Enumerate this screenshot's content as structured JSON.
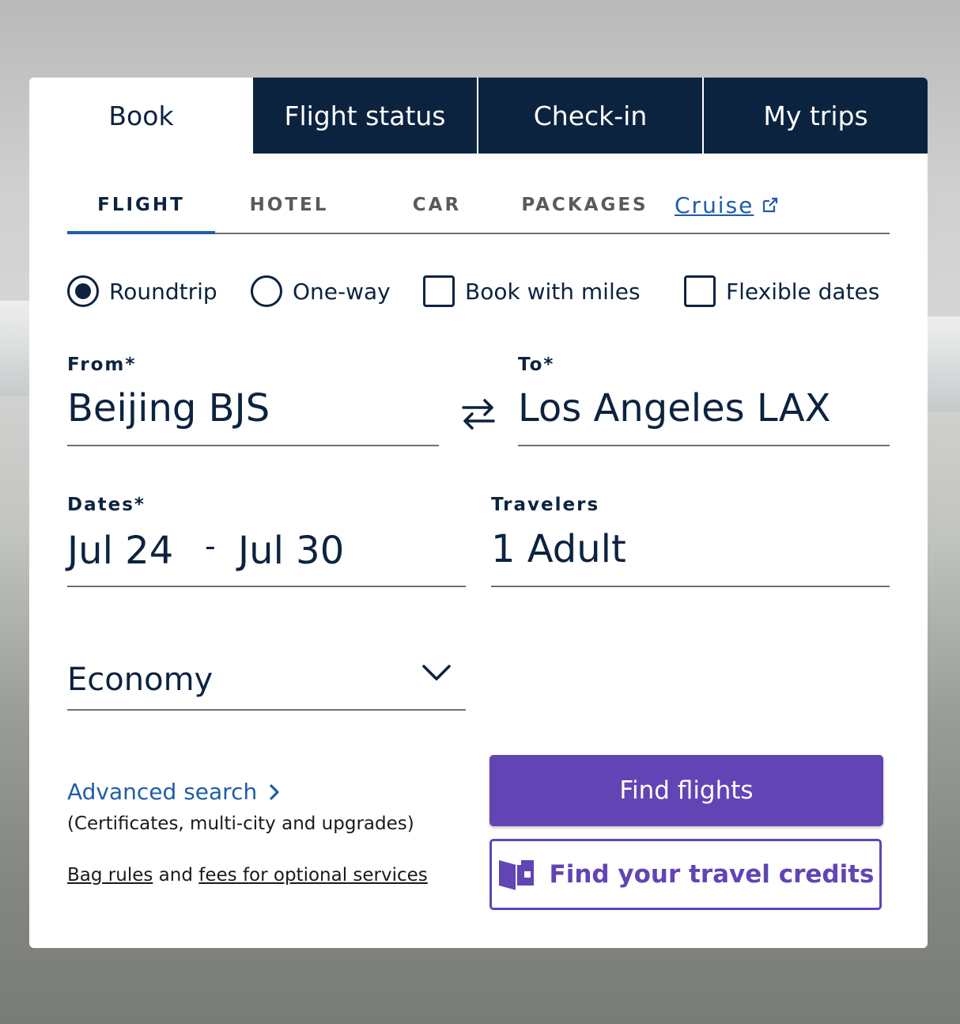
{
  "top_tabs": [
    {
      "label": "Book"
    },
    {
      "label": "Flight status"
    },
    {
      "label": "Check-in"
    },
    {
      "label": "My trips"
    }
  ],
  "sub_tabs": [
    {
      "label": "FLIGHT"
    },
    {
      "label": "HOTEL"
    },
    {
      "label": "CAR"
    },
    {
      "label": "PACKAGES"
    },
    {
      "label": "Cruise",
      "icon": "external-link-icon"
    }
  ],
  "trip_options": {
    "roundtrip": {
      "label": "Roundtrip",
      "selected": true
    },
    "oneway": {
      "label": "One-way",
      "selected": false
    },
    "miles": {
      "label": "Book with miles",
      "checked": false
    },
    "flexible": {
      "label": "Flexible dates",
      "checked": false
    }
  },
  "from": {
    "label": "From*",
    "value": "Beijing BJS"
  },
  "to": {
    "label": "To*",
    "value": "Los Angeles LAX"
  },
  "dates": {
    "label": "Dates*",
    "depart": "Jul 24",
    "separator": "-",
    "return": "Jul 30"
  },
  "travelers": {
    "label": "Travelers",
    "value": "1 Adult"
  },
  "cabin": {
    "value": "Economy"
  },
  "advanced": {
    "label": "Advanced search",
    "sub": "(Certificates, multi-city and upgrades)"
  },
  "bag": {
    "link1": "Bag rules",
    "connector": " and ",
    "link2": "fees for optional services"
  },
  "buttons": {
    "find_flights": "Find flights",
    "travel_credits": "Find your travel credits"
  },
  "colors": {
    "navy": "#0c2340",
    "accent": "#6244b5",
    "link": "#1f5da8"
  }
}
